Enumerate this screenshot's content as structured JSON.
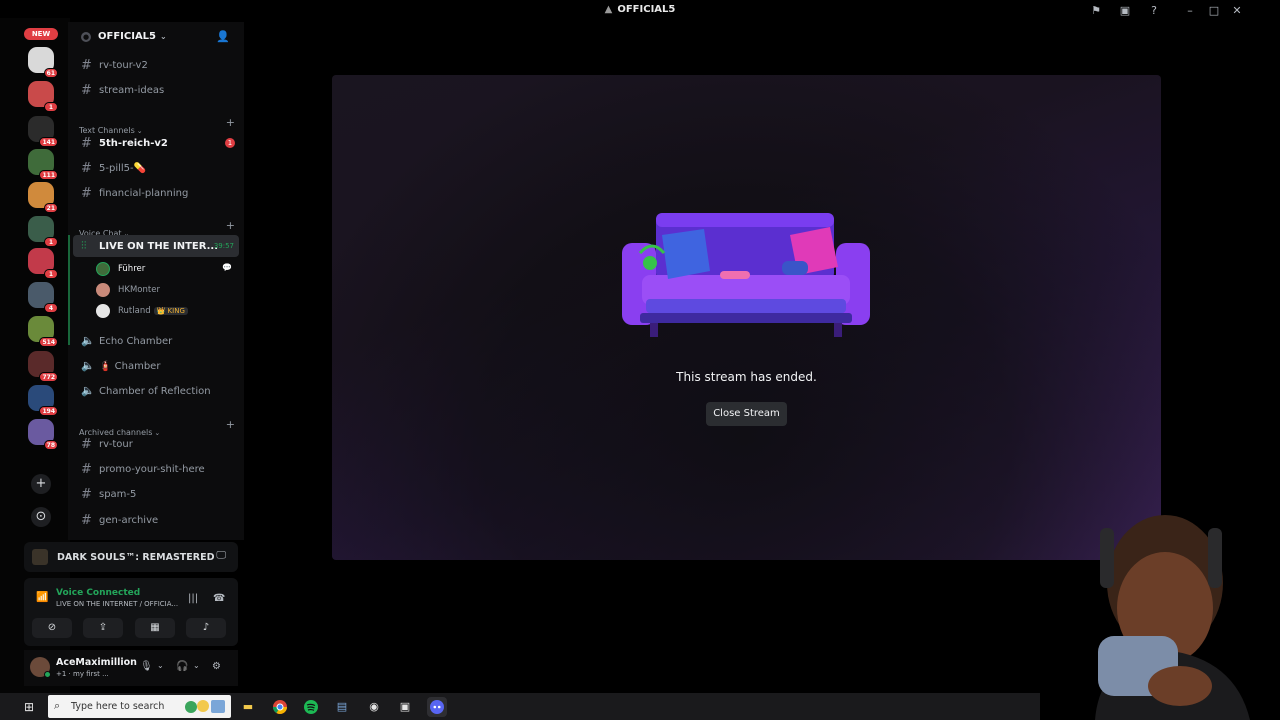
{
  "window": {
    "title": "OFFICIAL5",
    "icons": [
      "flag-icon",
      "inbox-icon",
      "help-icon",
      "minimize-icon",
      "maximize-icon",
      "close-icon"
    ]
  },
  "rail": {
    "new_badge": "NEW",
    "servers": [
      {
        "badge": "61",
        "color": "#d9d9d9"
      },
      {
        "badge": "1",
        "color": "#c94a4a"
      },
      {
        "badge": "141",
        "color": "#2b2b2b"
      },
      {
        "badge": "111",
        "color": "#3f6b3a"
      },
      {
        "badge": "21",
        "color": "#d08a3c"
      },
      {
        "badge": "1",
        "color": "#3a5d4a"
      },
      {
        "badge": "1",
        "color": "#c23a4a"
      },
      {
        "badge": "4",
        "color": "#4a5a6a"
      },
      {
        "badge": "514",
        "color": "#6a8a3a"
      },
      {
        "badge": "772",
        "color": "#5a2a2a"
      },
      {
        "badge": "194",
        "color": "#2a4a7a"
      },
      {
        "badge": "78",
        "color": "#6a5aa0"
      }
    ],
    "add_server": "+",
    "discover": "⊙"
  },
  "server": {
    "name": "OFFICIAL5"
  },
  "channels": {
    "top": [
      {
        "name": "rv-tour-v2"
      },
      {
        "name": "stream-ideas"
      }
    ],
    "text_category": "Text Channels",
    "text": [
      {
        "name": "5th-reich-v2",
        "unread": true,
        "mentions": "1"
      },
      {
        "name": "5-pill5-💊"
      },
      {
        "name": "financial-planning"
      }
    ],
    "voice_category": "Voice Chat",
    "live_channel": {
      "name": "LIVE ON THE INTER...",
      "timer": "39:57"
    },
    "voice_users": [
      {
        "name": "Führer"
      },
      {
        "name": "HKMonter"
      },
      {
        "name": "Rutland",
        "tag": "👑 KING"
      }
    ],
    "voice": [
      {
        "name": "Echo Chamber"
      },
      {
        "name": "🧯 Chamber"
      },
      {
        "name": "Chamber of Reflection"
      }
    ],
    "archived_category": "Archived channels",
    "archived": [
      {
        "name": "rv-tour"
      },
      {
        "name": "promo-your-shit-here"
      },
      {
        "name": "spam-5"
      },
      {
        "name": "gen-archive"
      }
    ]
  },
  "activity": {
    "game": "DARK SOULS™: REMASTERED"
  },
  "voice_panel": {
    "status": "Voice Connected",
    "location": "LIVE ON THE INTERNET / OFFICIA..."
  },
  "user": {
    "name": "AceMaximillion",
    "status": "+1 · my first ..."
  },
  "stream": {
    "message": "This stream has ended.",
    "close_label": "Close Stream"
  },
  "taskbar": {
    "search_placeholder": "Type here to search"
  },
  "colors": {
    "accent_green": "#23a55a",
    "mention_red": "#e03e43",
    "stage_purple": "#3b2257"
  }
}
